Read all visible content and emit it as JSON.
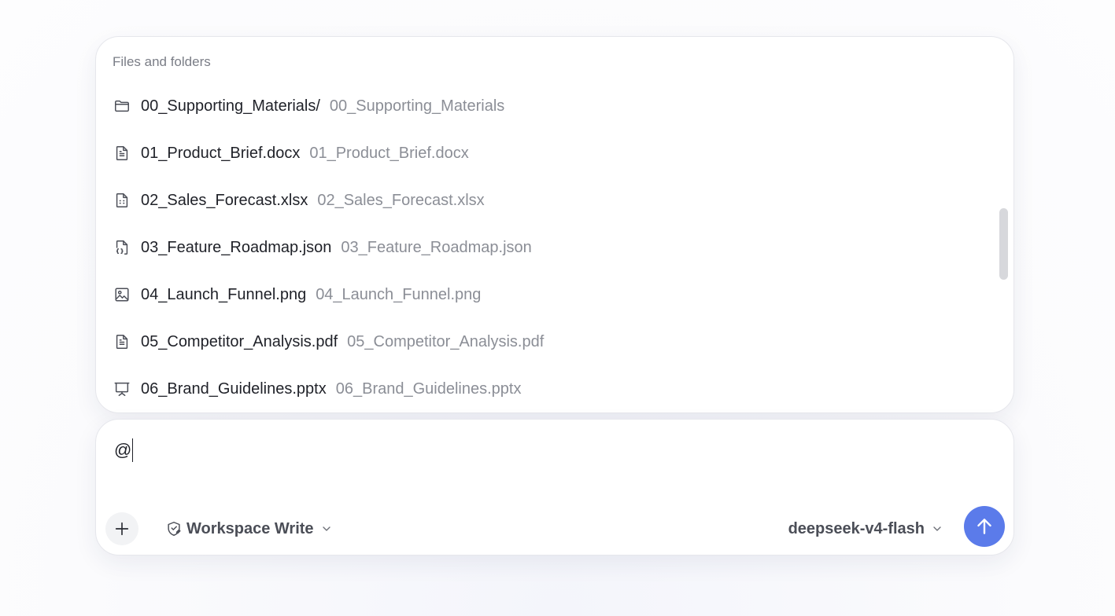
{
  "popup": {
    "heading": "Files and folders",
    "items": [
      {
        "icon": "folder-icon",
        "name": "00_Supporting_Materials/",
        "path": "00_Supporting_Materials"
      },
      {
        "icon": "document-icon",
        "name": "01_Product_Brief.docx",
        "path": "01_Product_Brief.docx"
      },
      {
        "icon": "spreadsheet-icon",
        "name": "02_Sales_Forecast.xlsx",
        "path": "02_Sales_Forecast.xlsx"
      },
      {
        "icon": "code-file-icon",
        "name": "03_Feature_Roadmap.json",
        "path": "03_Feature_Roadmap.json"
      },
      {
        "icon": "image-icon",
        "name": "04_Launch_Funnel.png",
        "path": "04_Launch_Funnel.png"
      },
      {
        "icon": "document-icon",
        "name": "05_Competitor_Analysis.pdf",
        "path": "05_Competitor_Analysis.pdf"
      },
      {
        "icon": "presentation-icon",
        "name": "06_Brand_Guidelines.pptx",
        "path": "06_Brand_Guidelines.pptx"
      }
    ]
  },
  "composer": {
    "input_value": "@",
    "attach_icon": "plus-icon",
    "permission_icon": "shield-edit-icon",
    "permission_label": "Workspace Write",
    "model_label": "deepseek-v4-flash",
    "send_icon": "arrow-up-icon"
  },
  "colors": {
    "accent": "#5b7bea",
    "text_primary": "#1f2128",
    "text_secondary": "#8b8e96"
  }
}
